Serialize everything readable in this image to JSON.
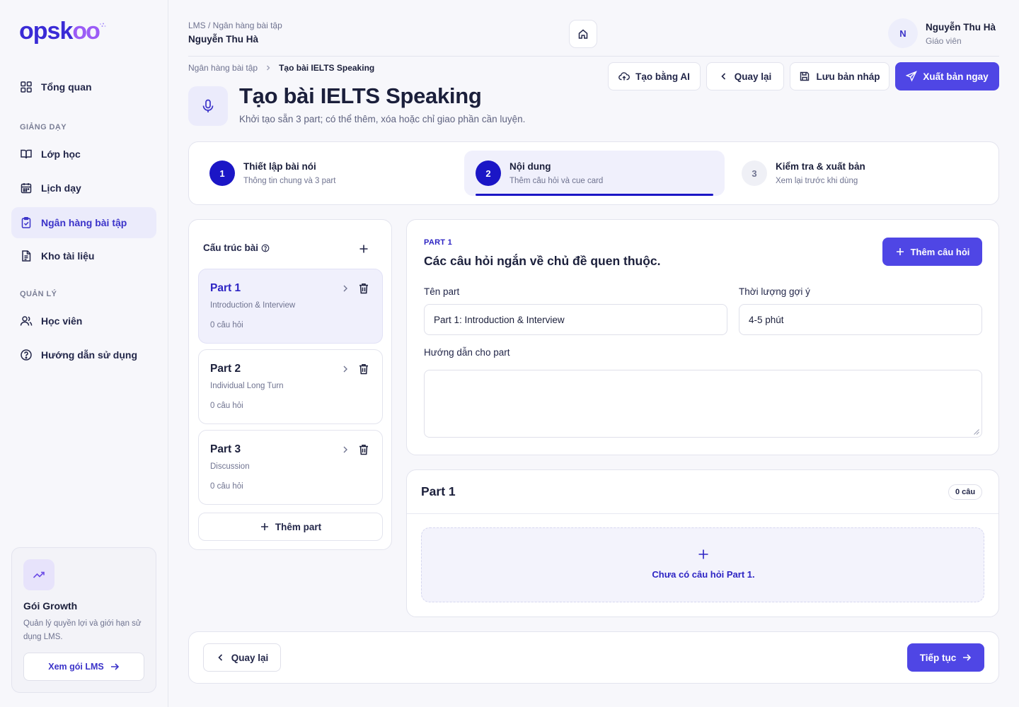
{
  "brand": {
    "logo_text": "opsk",
    "logo_tail": "oo",
    "accent": "#4f46e5",
    "accent_dark": "#1b16c6"
  },
  "sidebar": {
    "overview": "Tổng quan",
    "section_teaching": "GIẢNG DẠY",
    "items_teaching": [
      {
        "label": "Lớp học",
        "icon": "book-open-icon"
      },
      {
        "label": "Lịch dạy",
        "icon": "calendar-icon"
      },
      {
        "label": "Ngân hàng bài tập",
        "icon": "clipboard-check-icon",
        "active": true
      },
      {
        "label": "Kho tài liệu",
        "icon": "file-text-icon"
      }
    ],
    "section_manage": "QUẢN LÝ",
    "items_manage": [
      {
        "label": "Học viên",
        "icon": "users-icon"
      },
      {
        "label": "Hướng dẫn sử dụng",
        "icon": "help-circle-icon"
      }
    ],
    "plan": {
      "title": "Gói Growth",
      "desc": "Quản lý quyền lợi và giới hạn sử dụng LMS.",
      "button": "Xem gói LMS"
    }
  },
  "header": {
    "breadcrumb": "LMS / Ngân hàng bài tập",
    "user_name": "Nguyễn Thu Hà",
    "avatar_initial": "N",
    "profile_name": "Nguyễn Thu Hà",
    "profile_role": "Giáo viên"
  },
  "page": {
    "crumb_parent": "Ngân hàng bài tập",
    "crumb_current": "Tạo bài IELTS Speaking",
    "title": "Tạo bài IELTS Speaking",
    "subtitle": "Khởi tạo sẵn 3 part; có thể thêm, xóa hoặc chỉ giao phần cần luyện.",
    "actions": {
      "ai": "Tạo bằng AI",
      "back": "Quay lại",
      "draft": "Lưu bản nháp",
      "publish": "Xuất bản ngay"
    }
  },
  "steps": [
    {
      "num": "1",
      "title": "Thiết lập bài nói",
      "sub": "Thông tin chung và 3 part"
    },
    {
      "num": "2",
      "title": "Nội dung",
      "sub": "Thêm câu hỏi và cue card"
    },
    {
      "num": "3",
      "title": "Kiểm tra & xuất bản",
      "sub": "Xem lại trước khi dùng"
    }
  ],
  "structure": {
    "heading": "Cấu trúc bài",
    "parts": [
      {
        "name": "Part 1",
        "desc": "Introduction & Interview",
        "count": "0 câu hỏi"
      },
      {
        "name": "Part 2",
        "desc": "Individual Long Turn",
        "count": "0 câu hỏi"
      },
      {
        "name": "Part 3",
        "desc": "Discussion",
        "count": "0 câu hỏi"
      }
    ],
    "add_part": "Thêm part"
  },
  "editor": {
    "kicker": "PART 1",
    "title": "Các câu hỏi ngắn về chủ đề quen thuộc.",
    "add_question": "Thêm câu hỏi",
    "name_label": "Tên part",
    "name_value": "Part 1: Introduction & Interview",
    "duration_label": "Thời lượng gợi ý",
    "duration_value": "4-5 phút",
    "guide_label": "Hướng dẫn cho part",
    "guide_value": ""
  },
  "questions": {
    "title": "Part 1",
    "badge": "0 câu",
    "empty": "Chưa có câu hỏi Part 1."
  },
  "footer": {
    "back": "Quay lại",
    "next": "Tiếp tục"
  }
}
